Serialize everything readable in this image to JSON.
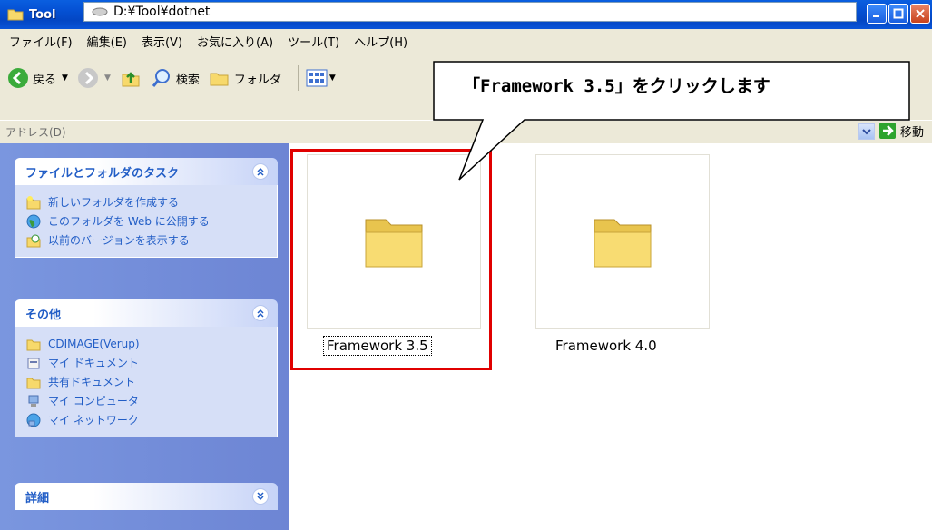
{
  "window": {
    "title": "Tool"
  },
  "menu": {
    "items": [
      "ファイル(F)",
      "編集(E)",
      "表示(V)",
      "お気に入り(A)",
      "ツール(T)",
      "ヘルプ(H)"
    ]
  },
  "toolbar": {
    "back_label": "戻る",
    "search_label": "検索",
    "folders_label": "フォルダ"
  },
  "address": {
    "label": "アドレス(D)",
    "path": "D:¥Tool¥dotnet",
    "go_label": "移動"
  },
  "taskpane": {
    "file_tasks": {
      "title": "ファイルとフォルダのタスク",
      "items": [
        "新しいフォルダを作成する",
        "このフォルダを Web に公開する",
        "以前のバージョンを表示する"
      ]
    },
    "other": {
      "title": "その他",
      "items": [
        "CDIMAGE(Verup)",
        "マイ ドキュメント",
        "共有ドキュメント",
        "マイ コンピュータ",
        "マイ ネットワーク"
      ]
    },
    "details": {
      "title": "詳細"
    }
  },
  "folders": [
    {
      "name": "Framework 3.5"
    },
    {
      "name": "Framework 4.0"
    }
  ],
  "callout": {
    "text": "「Framework 3.5」をクリックします"
  },
  "colors": {
    "title_bar": "#0551d4",
    "highlight": "#e00000",
    "task_link": "#215dc6"
  }
}
